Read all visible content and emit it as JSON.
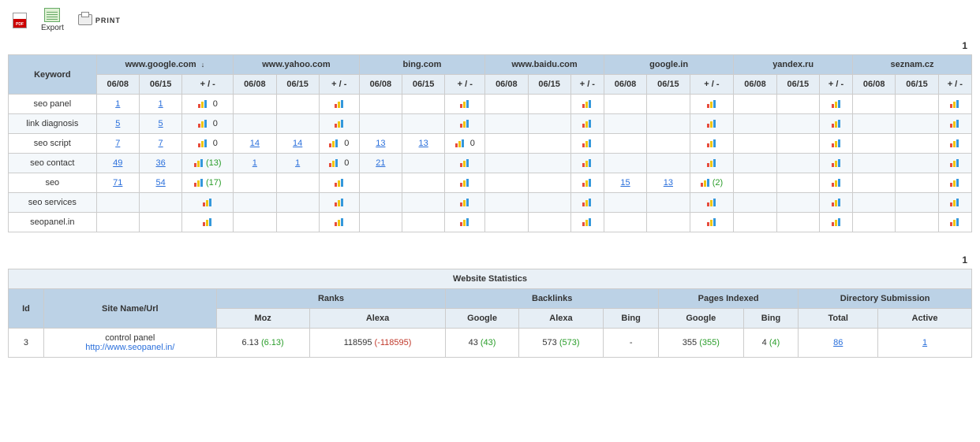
{
  "toolbar": {
    "export": "Export",
    "print": "PRINT"
  },
  "pager": {
    "page": "1"
  },
  "headers": {
    "keyword": "Keyword",
    "engines": [
      "www.google.com",
      "www.yahoo.com",
      "bing.com",
      "www.baidu.com",
      "google.in",
      "yandex.ru",
      "seznam.cz"
    ],
    "sort_col": 0,
    "subs": [
      "06/08",
      "06/15",
      "+ / -"
    ]
  },
  "rows": [
    {
      "kw": "seo panel",
      "cells": [
        [
          "1",
          "1",
          "0"
        ],
        [
          "",
          "",
          ""
        ],
        [
          "",
          "",
          ""
        ],
        [
          "",
          "",
          ""
        ],
        [
          "",
          "",
          ""
        ],
        [
          "",
          "",
          ""
        ],
        [
          "",
          "",
          ""
        ]
      ]
    },
    {
      "kw": "link diagnosis",
      "cells": [
        [
          "5",
          "5",
          "0"
        ],
        [
          "",
          "",
          ""
        ],
        [
          "",
          "",
          ""
        ],
        [
          "",
          "",
          ""
        ],
        [
          "",
          "",
          ""
        ],
        [
          "",
          "",
          ""
        ],
        [
          "",
          "",
          ""
        ]
      ]
    },
    {
      "kw": "seo script",
      "cells": [
        [
          "7",
          "7",
          "0"
        ],
        [
          "14",
          "14",
          "0"
        ],
        [
          "13",
          "13",
          "0"
        ],
        [
          "",
          "",
          ""
        ],
        [
          "",
          "",
          ""
        ],
        [
          "",
          "",
          ""
        ],
        [
          "",
          "",
          ""
        ]
      ]
    },
    {
      "kw": "seo contact",
      "cells": [
        [
          "49",
          "36",
          "(13)"
        ],
        [
          "1",
          "1",
          "0"
        ],
        [
          "21",
          "",
          ""
        ],
        [
          "",
          "",
          ""
        ],
        [
          "",
          "",
          ""
        ],
        [
          "",
          "",
          ""
        ],
        [
          "",
          "",
          ""
        ]
      ]
    },
    {
      "kw": "seo",
      "cells": [
        [
          "71",
          "54",
          "(17)"
        ],
        [
          "",
          "",
          ""
        ],
        [
          "",
          "",
          ""
        ],
        [
          "",
          "",
          ""
        ],
        [
          "15",
          "13",
          "(2)"
        ],
        [
          "",
          "",
          ""
        ],
        [
          "",
          "",
          ""
        ]
      ]
    },
    {
      "kw": "seo services",
      "cells": [
        [
          "",
          "",
          ""
        ],
        [
          "",
          "",
          ""
        ],
        [
          "",
          "",
          ""
        ],
        [
          "",
          "",
          ""
        ],
        [
          "",
          "",
          ""
        ],
        [
          "",
          "",
          ""
        ],
        [
          "",
          "",
          ""
        ]
      ]
    },
    {
      "kw": "seopanel.in",
      "cells": [
        [
          "",
          "",
          ""
        ],
        [
          "",
          "",
          ""
        ],
        [
          "",
          "",
          ""
        ],
        [
          "",
          "",
          ""
        ],
        [
          "",
          "",
          ""
        ],
        [
          "",
          "",
          ""
        ],
        [
          "",
          "",
          ""
        ]
      ]
    }
  ],
  "stats": {
    "title": "Website Statistics",
    "cols": {
      "id": "Id",
      "site": "Site Name/Url",
      "ranks": "Ranks",
      "backlinks": "Backlinks",
      "pages": "Pages Indexed",
      "dir": "Directory Submission",
      "moz": "Moz",
      "alexa": "Alexa",
      "google": "Google",
      "bing": "Bing",
      "total": "Total",
      "active": "Active"
    },
    "row": {
      "id": "3",
      "name": "control panel",
      "url": "http://www.seopanel.in/",
      "moz": "6.13",
      "moz_d": "(6.13)",
      "alexa_r": "118595",
      "alexa_rd": "(-118595)",
      "bl_g": "43",
      "bl_gd": "(43)",
      "bl_a": "573",
      "bl_ad": "(573)",
      "bl_b": "-",
      "pi_g": "355",
      "pi_gd": "(355)",
      "pi_b": "4",
      "pi_bd": "(4)",
      "ds_t": "86",
      "ds_a": "1"
    }
  }
}
